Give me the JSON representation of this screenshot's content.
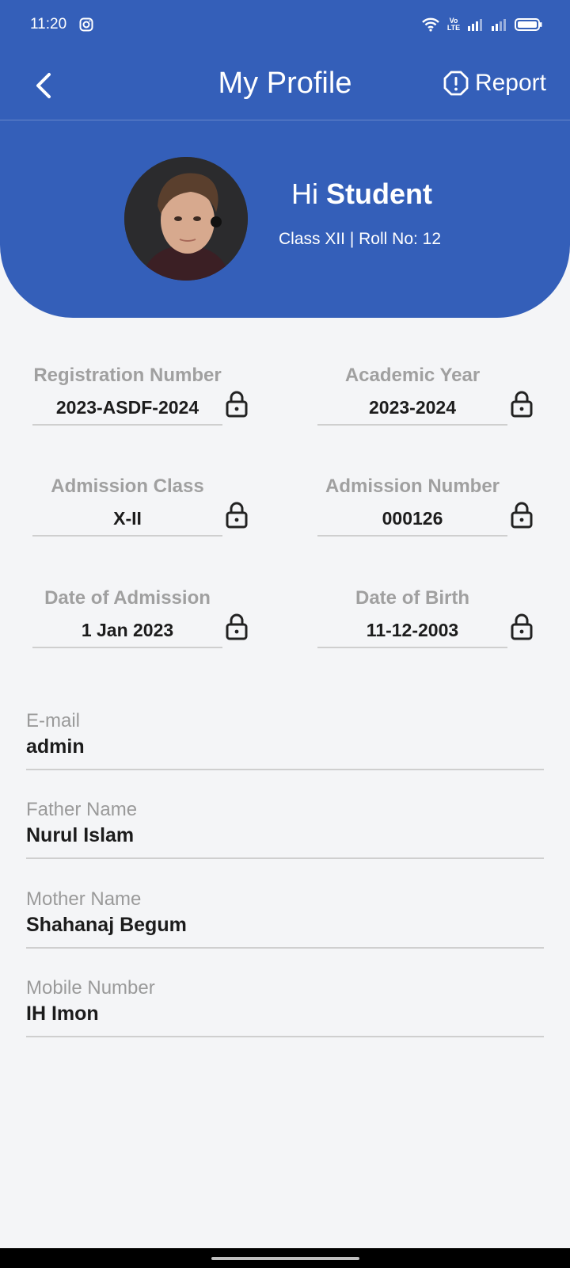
{
  "status_bar": {
    "time": "11:20",
    "volte": "Vo LTE"
  },
  "app_bar": {
    "title": "My Profile",
    "report_label": "Report"
  },
  "profile": {
    "greeting": "Hi",
    "name": "Student",
    "subtitle": "Class XII | Roll No: 12"
  },
  "locked_fields": [
    {
      "label": "Registration Number",
      "value": "2023-ASDF-2024"
    },
    {
      "label": "Academic Year",
      "value": "2023-2024"
    },
    {
      "label": "Admission Class",
      "value": "X-II"
    },
    {
      "label": "Admission Number",
      "value": "000126"
    },
    {
      "label": "Date of Admission",
      "value": "1 Jan 2023"
    },
    {
      "label": "Date of Birth",
      "value": "11-12-2003"
    }
  ],
  "fields": [
    {
      "label": "E-mail",
      "value": "admin"
    },
    {
      "label": "Father Name",
      "value": "Nurul Islam"
    },
    {
      "label": "Mother Name",
      "value": "Shahanaj Begum"
    },
    {
      "label": "Mobile Number",
      "value": "IH Imon"
    }
  ],
  "colors": {
    "primary": "#345fb9",
    "background": "#f4f5f7",
    "muted": "#a0a0a0"
  }
}
